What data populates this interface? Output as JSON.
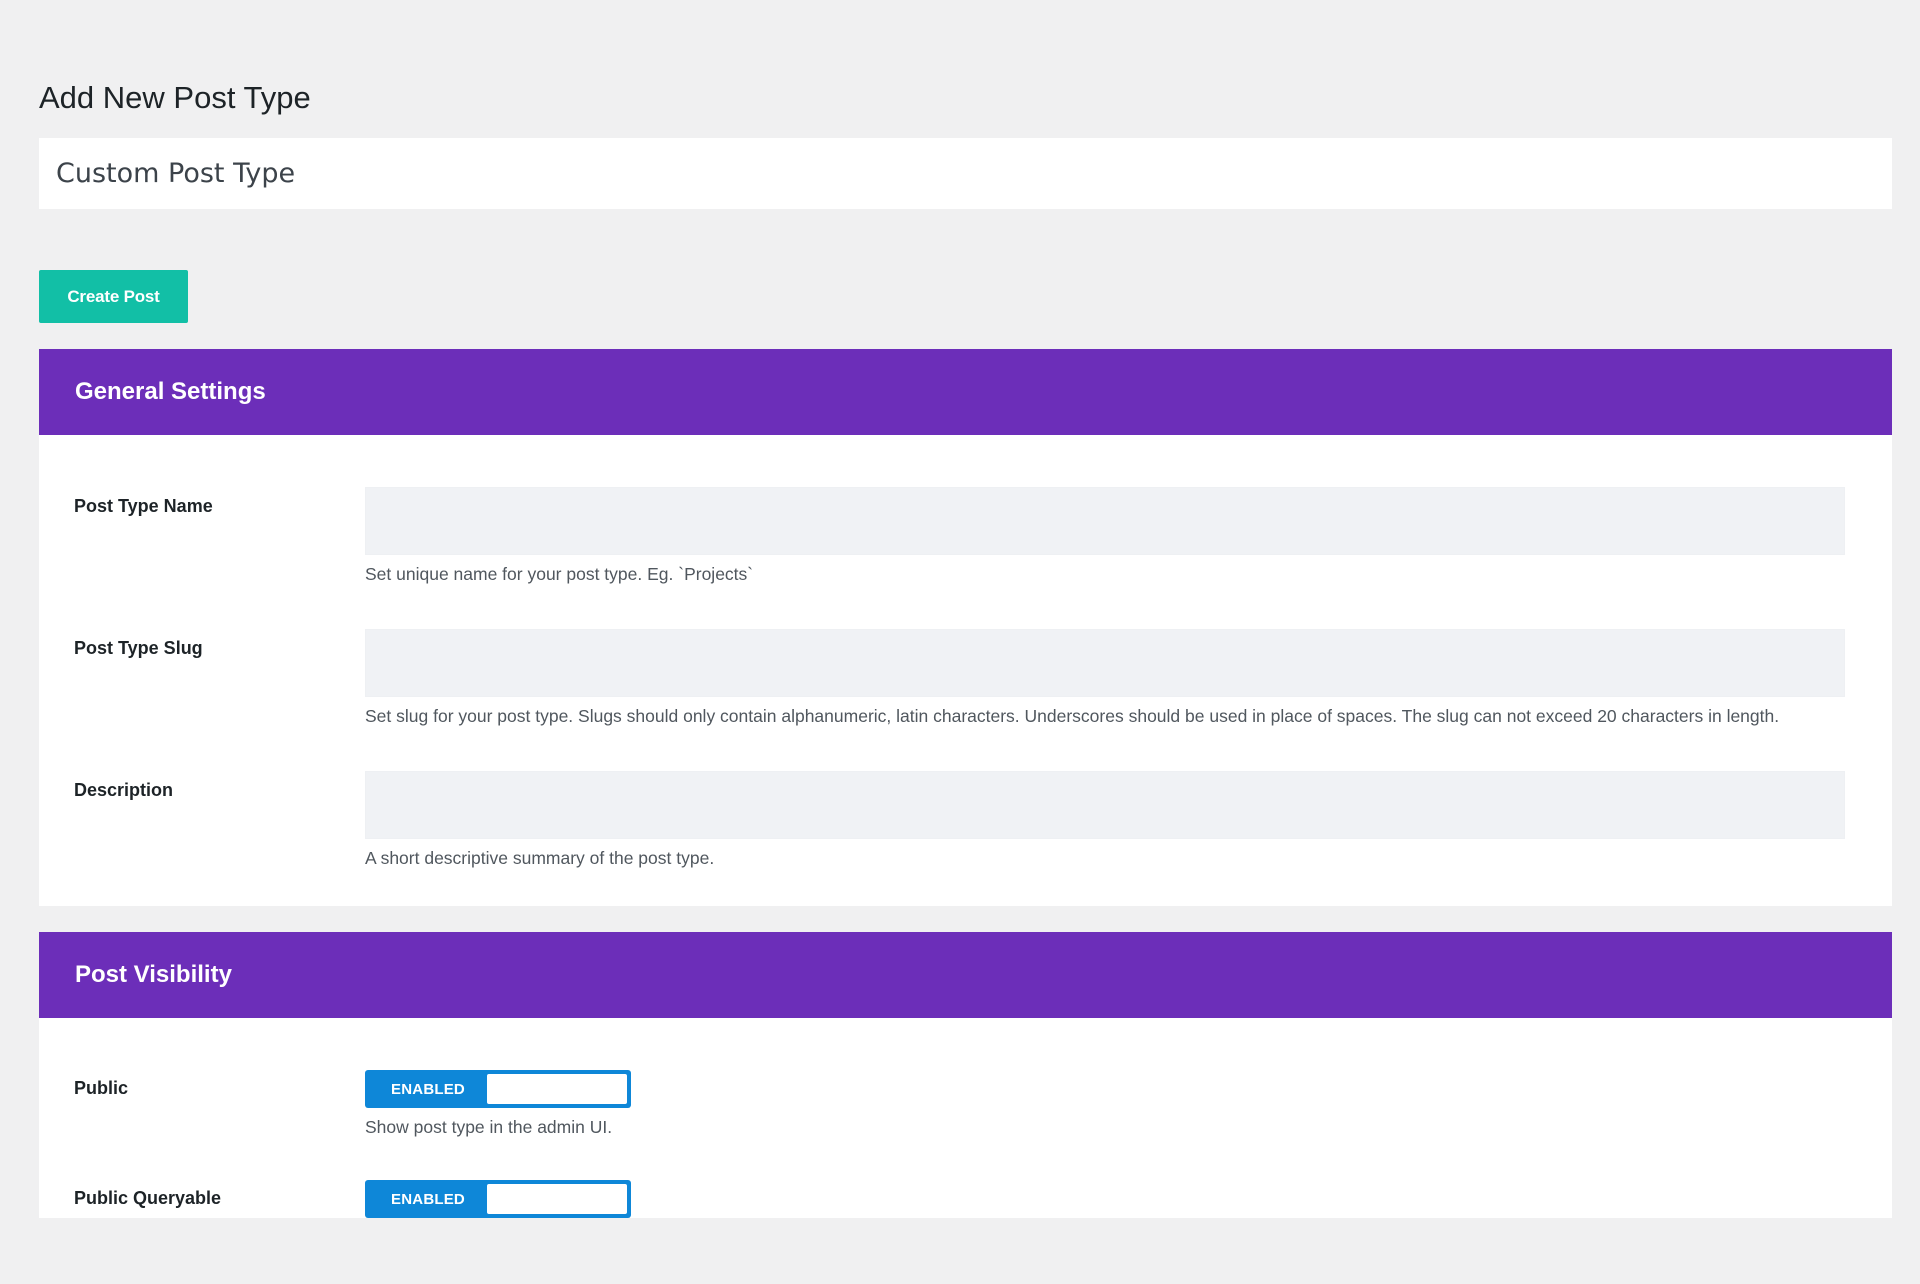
{
  "page": {
    "title": "Add New Post Type"
  },
  "title_input": {
    "value": "Custom Post Type"
  },
  "create_button": {
    "label": "Create Post"
  },
  "general_settings": {
    "header": "General Settings",
    "fields": [
      {
        "label": "Post Type Name",
        "value": "",
        "help": "Set unique name for your post type. Eg. `Projects`"
      },
      {
        "label": "Post Type Slug",
        "value": "",
        "help": "Set slug for your post type. Slugs should only contain alphanumeric, latin characters. Underscores should be used in place of spaces. The slug can not exceed 20 characters in length."
      },
      {
        "label": "Description",
        "value": "",
        "help": "A short descriptive summary of the post type."
      }
    ]
  },
  "post_visibility": {
    "header": "Post Visibility",
    "toggles": [
      {
        "label": "Public",
        "state": "ENABLED",
        "help": "Show post type in the admin UI."
      },
      {
        "label": "Public Queryable",
        "state": "ENABLED",
        "help": ""
      }
    ]
  },
  "colors": {
    "accent_purple": "#6c2eb9",
    "button_teal": "#12bfa6",
    "toggle_blue": "#0e87d8",
    "background": "#f0f0f1"
  }
}
